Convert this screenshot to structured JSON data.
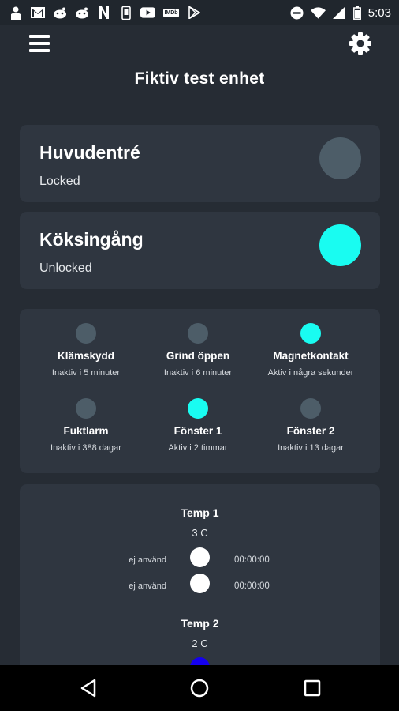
{
  "statusbar": {
    "time": "5:03",
    "left_icons": [
      "person-icon",
      "gmail-icon",
      "reddit-icon",
      "reddit-icon",
      "netflix-icon",
      "phone-icon",
      "youtube-icon",
      "imdb-icon",
      "play-store-icon"
    ],
    "imdb_text": "IMDb",
    "right_icons": [
      "do-not-disturb-icon",
      "wifi-icon",
      "signal-icon",
      "battery-icon"
    ]
  },
  "appbar": {
    "title": "Fiktiv test enhet",
    "menu_icon": "hamburger-menu-icon",
    "settings_icon": "gear-icon"
  },
  "locks": [
    {
      "name": "Huvudentré",
      "status": "Locked",
      "indicator_color": "#4d5d68"
    },
    {
      "name": "Köksingång",
      "status": "Unlocked",
      "indicator_color": "#19fcf1"
    }
  ],
  "sensors": [
    {
      "name": "Klämskydd",
      "status": "Inaktiv i 5 minuter",
      "active": false
    },
    {
      "name": "Grind öppen",
      "status": "Inaktiv i 6 minuter",
      "active": false
    },
    {
      "name": "Magnetkontakt",
      "status": "Aktiv i några sekunder",
      "active": true
    },
    {
      "name": "Fuktlarm",
      "status": "Inaktiv i 388 dagar",
      "active": false
    },
    {
      "name": "Fönster 1",
      "status": "Aktiv i 2 timmar",
      "active": true
    },
    {
      "name": "Fönster 2",
      "status": "Inaktiv i 13 dagar",
      "active": false
    }
  ],
  "temps": [
    {
      "title": "Temp 1",
      "value": "3 C",
      "rows": [
        {
          "label": "ej använd",
          "time": "00:00:00"
        },
        {
          "label": "ej använd",
          "time": "00:00:00"
        }
      ]
    },
    {
      "title": "Temp 2",
      "value": "2 C",
      "indicator_color": "#1400f0"
    }
  ],
  "colors": {
    "background": "#262c34",
    "card": "#2f3640",
    "active": "#19fcf1",
    "inactive": "#4d5d68"
  },
  "navbar": {
    "back_icon": "back-triangle-icon",
    "home_icon": "home-circle-icon",
    "recents_icon": "recents-square-icon"
  }
}
